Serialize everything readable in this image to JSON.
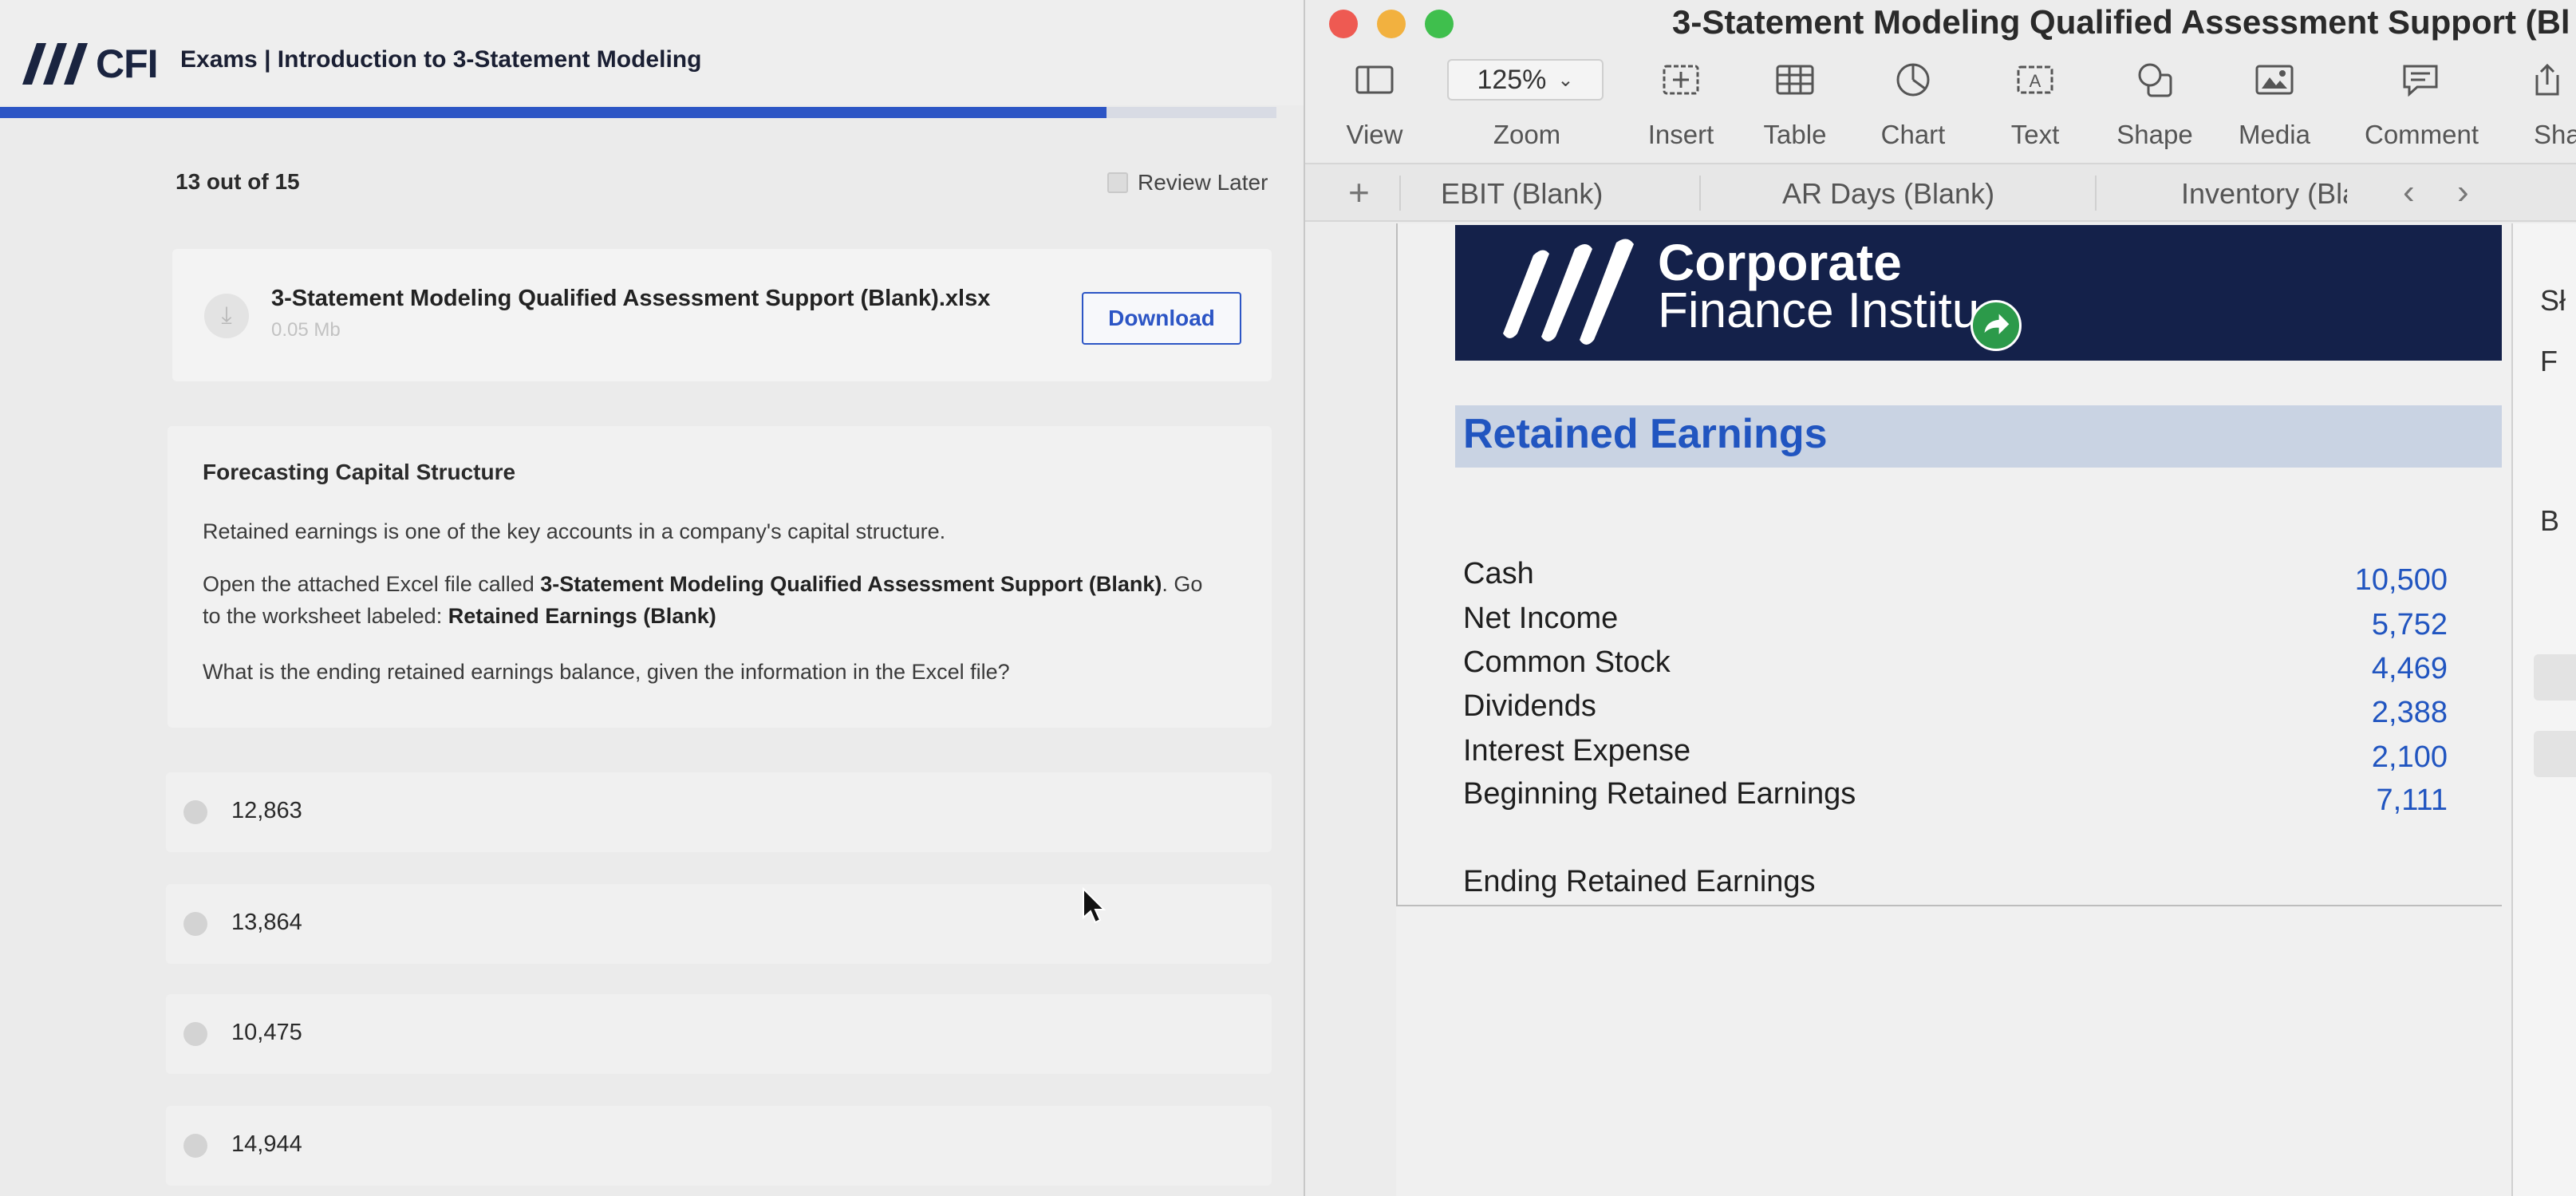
{
  "exam": {
    "logo_text": "CFI",
    "title": "Exams | Introduction to 3-Statement Modeling",
    "progress_fraction": 0.867,
    "question_counter": "13 out of 15",
    "review_later_label": "Review Later",
    "attachment": {
      "file_name": "3-Statement Modeling Qualified Assessment Support (Blank).xlsx",
      "file_size": "0.05 Mb",
      "download_label": "Download"
    },
    "question": {
      "heading": "Forecasting Capital Structure",
      "intro": "Retained earnings is one of the key accounts in a company's capital structure.",
      "instruction_prefix": "Open the attached Excel file called ",
      "instruction_file": "3-Statement Modeling Qualified Assessment Support (Blank)",
      "instruction_middle": ". Go to the worksheet labeled: ",
      "instruction_sheet": "Retained Earnings (Blank)",
      "prompt": "What is the ending retained earnings balance, given the information in the Excel file?"
    },
    "answers": [
      "12,863",
      "13,864",
      "10,475",
      "14,944"
    ]
  },
  "numbers": {
    "window_title": "3-Statement Modeling Qualified Assessment Support (Bl",
    "toolbar": {
      "view": "View",
      "zoom_value": "125%",
      "zoom": "Zoom",
      "insert": "Insert",
      "table": "Table",
      "chart": "Chart",
      "text": "Text",
      "shape": "Shape",
      "media": "Media",
      "comment": "Comment",
      "share": "Sha"
    },
    "sheet_tabs": [
      "EBIT (Blank)",
      "AR Days (Blank)",
      "Inventory (Blar"
    ],
    "banner": {
      "line1": "Corporate",
      "line2": "Finance Institu"
    },
    "sheet_title": "Retained Earnings",
    "rows": [
      {
        "label": "Cash",
        "value": "10,500"
      },
      {
        "label": "Net Income",
        "value": "5,752"
      },
      {
        "label": "Common Stock",
        "value": "4,469"
      },
      {
        "label": "Dividends",
        "value": "2,388"
      },
      {
        "label": "Interest Expense",
        "value": "2,100"
      },
      {
        "label": "Beginning Retained Earnings",
        "value": "7,111"
      }
    ],
    "ending_label": "Ending Retained Earnings",
    "right_panel": {
      "t1": "Sł",
      "t2": "F",
      "t3": "B"
    }
  },
  "colors": {
    "cfi_blue": "#2c55c5",
    "cfi_navy": "#14214a",
    "value_blue": "#2155c0",
    "header_band": "#c9d3e3"
  }
}
